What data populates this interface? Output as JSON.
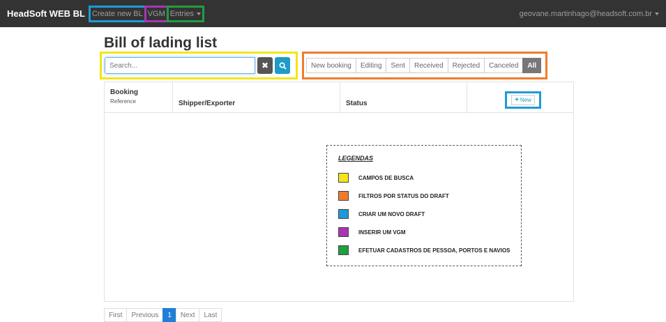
{
  "navbar": {
    "brand": "HeadSoft WEB BL",
    "create_new_bl": "Create new BL",
    "vgm": "VGM",
    "entries": "Entries",
    "user_email": "geovane.martinhago@headsoft.com.br"
  },
  "page": {
    "title": "Bill of lading list"
  },
  "search": {
    "placeholder": "Search..."
  },
  "filters": [
    "New booking",
    "Editing",
    "Sent",
    "Received",
    "Rejected",
    "Canceled",
    "All"
  ],
  "active_filter": "All",
  "table": {
    "headers": {
      "booking_title": "Booking",
      "booking_sub": "Reference",
      "shipper": "Shipper/Exporter",
      "status": "Status"
    },
    "new_button": "New",
    "rows": []
  },
  "legend": {
    "title": "LEGENDAS",
    "items": [
      {
        "label": "CAMPOS DE BUSCA",
        "color": "#f2e51a"
      },
      {
        "label": "FILTROS POR STATUS DO DRAFT",
        "color": "#f07c2c"
      },
      {
        "label": "CRIAR UM NOVO DRAFT",
        "color": "#1e9ad6"
      },
      {
        "label": "INSERIR UM VGM",
        "color": "#a935b5"
      },
      {
        "label": "EFETUAR CADASTROS DE PESSOA, PORTOS E NAVIOS",
        "color": "#1f9f3f"
      }
    ]
  },
  "pagination": {
    "first": "First",
    "previous": "Previous",
    "current": "1",
    "next": "Next",
    "last": "Last"
  },
  "colors": {
    "navbar_bg": "#333333",
    "search_highlight": "#f2e51a",
    "filters_highlight": "#f07c2c",
    "new_highlight": "#1e9ad6",
    "vgm_highlight": "#a935b5",
    "entries_highlight": "#1f9f3f",
    "primary": "#1f9bc9"
  }
}
